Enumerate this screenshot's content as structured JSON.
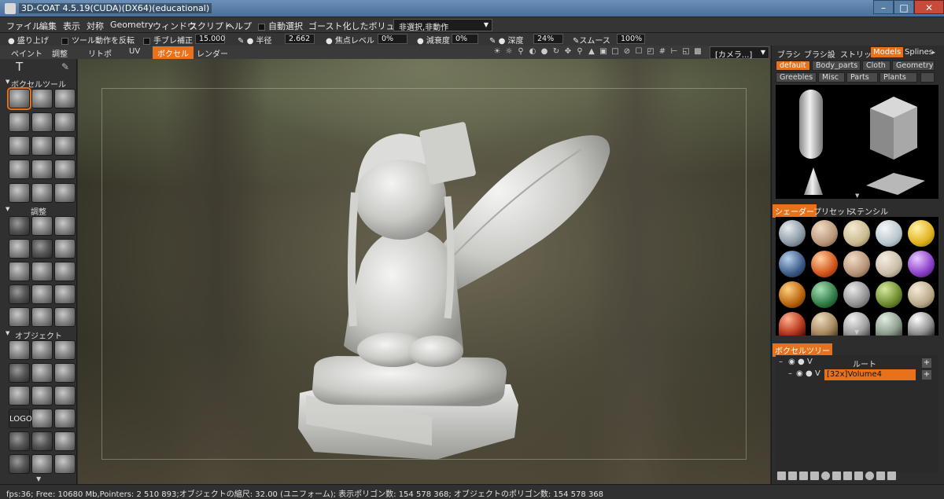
{
  "window": {
    "title": "3D-COAT 4.5.19(CUDA)(DX64)(educational)",
    "min_icon": "minimize-icon",
    "max_icon": "maximize-icon",
    "close_icon": "close-icon"
  },
  "menu": {
    "items": [
      "ファイル",
      "編集",
      "表示",
      "対称",
      "Geometry",
      "ウィンドウ",
      "スクリプト",
      "ヘルプ"
    ],
    "auto_select_label": "自動選択",
    "ghost_label": "ゴースト化したボリューム:",
    "ghost_value": "非選択,非動作"
  },
  "options": {
    "raise_label": "盛り上げ",
    "invert_label": "ツール動作を反転",
    "smooth_label": "手ブレ補正",
    "smooth_value": "15.000",
    "radius_label": "半径",
    "radius_value": "2.662",
    "focal_label": "焦点レベル",
    "focal_value": "0%",
    "falloff_label": "減衰度",
    "falloff_value": "0%",
    "depth_label": "深度",
    "depth_value": "24%",
    "smooth2_label": "スムース",
    "smooth2_value": "100%"
  },
  "rooms": {
    "tabs": [
      "ペイント",
      "調整",
      "リトポ",
      "UV",
      "ボクセル",
      "レンダー"
    ],
    "active": "ボクセル",
    "camera_label": "[カメラ...]"
  },
  "left": {
    "voxel_tools_header": "ボクセルツール",
    "adjust_header": "調整",
    "objects_header": "オブジェクト",
    "logo_tool": "LOGO"
  },
  "right": {
    "top_tabs": [
      "ブラシ",
      "ブラシ設",
      "ストリップ",
      "Models",
      "Splines"
    ],
    "active_top_tab": "Models",
    "model_categories": [
      "default",
      "Body_parts",
      "Cloth",
      "Geometry",
      "Greebles",
      "Misc",
      "Parts",
      "Plants"
    ],
    "active_category": "default",
    "shader_tabs": [
      "シェーダー",
      "プリセット",
      "ステンシル"
    ],
    "active_shader_tab": "シェーダー",
    "voxtree_tab": "ボクセルツリー",
    "root_label": "ルート",
    "vis_label": "V",
    "volume_name": "[32x]Volume4",
    "add_label": "+"
  },
  "status": {
    "text": "fps:36;   Free: 10680 Mb,Pointers: 2 510 893;オブジェクトの縮尺: 32.00 (ユニフォーム); 表示ポリゴン数: 154 578 368; オブジェクトのポリゴン数: 154 578 368"
  },
  "colors": {
    "accent": "#e8721c",
    "panel": "#2d2d2d",
    "model_bg": "#000000"
  }
}
